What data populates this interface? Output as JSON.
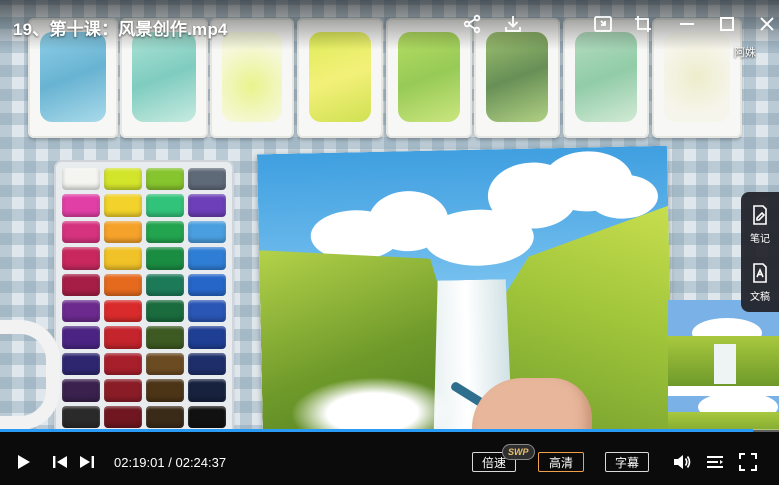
{
  "window": {
    "title": "19、第十课：风景创作.mp4"
  },
  "toolbar": {
    "share_icon": "share-icon",
    "download_icon": "download-icon",
    "pip_icon": "picture-in-picture-icon",
    "minimize_icon": "minimize-icon",
    "maximize_icon": "maximize-icon",
    "close_icon": "close-icon"
  },
  "overlay": {
    "avatar_text": "阿姝"
  },
  "side_panel": {
    "items": [
      {
        "label": "笔记",
        "icon": "note-edit-icon"
      },
      {
        "label": "文稿",
        "icon": "document-text-icon"
      }
    ]
  },
  "player": {
    "current_time": "02:19:01",
    "separator": "/",
    "total_time": "02:24:37",
    "progress": 0.9666,
    "speed_label": "倍速",
    "swp_badge": "SWP",
    "quality_label": "高清",
    "subtitle_label": "字幕",
    "accent": "#2a9bf4",
    "active_border": "#f0a24a"
  }
}
